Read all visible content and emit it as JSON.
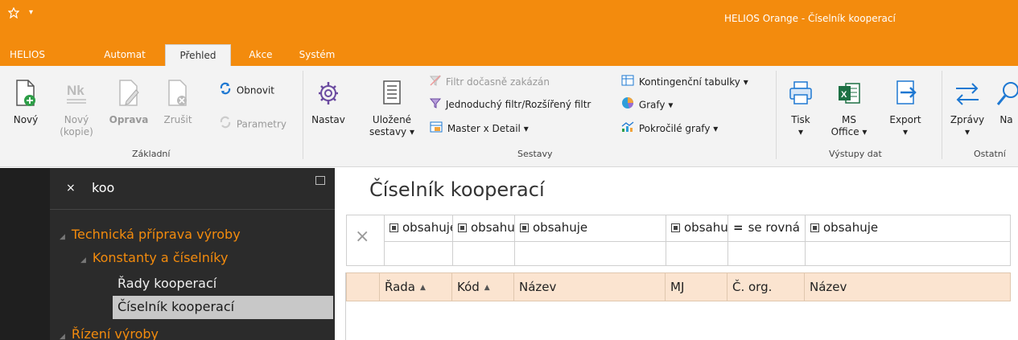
{
  "window": {
    "title": "HELIOS Orange - Číselník kooperací"
  },
  "tabs": [
    {
      "label": "HELIOS"
    },
    {
      "label": "Automat"
    },
    {
      "label": "Přehled"
    },
    {
      "label": "Akce"
    },
    {
      "label": "Systém"
    }
  ],
  "ribbon": {
    "zakladni": {
      "label": "Základní",
      "novy": "Nový",
      "novy_kopie_1": "Nový",
      "novy_kopie_2": "(kopie)",
      "oprava": "Oprava",
      "zrusit": "Zrušit",
      "obnovit": "Obnovit",
      "parametry": "Parametry"
    },
    "sestavy": {
      "label": "Sestavy",
      "nastav": "Nastav",
      "ulozene_1": "Uložené",
      "ulozene_2": "sestavy ▾",
      "filtr_docasne": "Filtr dočasně zakázán",
      "jednoduchy_filtr": "Jednoduchý filtr/Rozšířený filtr",
      "master_detail": "Master x Detail ▾",
      "kontingencni": "Kontingenční tabulky ▾",
      "grafy": "Grafy ▾",
      "pokrocile_grafy": "Pokročilé grafy ▾"
    },
    "vystupy": {
      "label": "Výstupy dat",
      "tisk": "Tisk",
      "tisk_arrow": "▾",
      "ms_1": "MS",
      "ms_2": "Office ▾",
      "export": "Export",
      "export_arrow": "▾"
    },
    "ostatni": {
      "label": "Ostatní",
      "zpravy": "Zprávy",
      "zpravy_arrow": "▾",
      "na": "Na"
    }
  },
  "nav": {
    "search_value": "koo",
    "close": "×",
    "tree": [
      {
        "label": "Technická příprava výroby"
      },
      {
        "label": "Konstanty a číselníky"
      },
      {
        "label": "Řady kooperací"
      },
      {
        "label": "Číselník kooperací"
      },
      {
        "label": "Řízení výroby"
      }
    ]
  },
  "main": {
    "title": "Číselník kooperací",
    "filter_clear": "×",
    "filters": [
      "obsahuje",
      "obsahuje",
      "obsahuje",
      "obsahuje",
      "se rovná",
      "obsahuje"
    ],
    "filter_eq_symbol": "=",
    "columns": [
      "Řada",
      "Kód",
      "Název",
      "MJ",
      "Č. org.",
      "Název"
    ],
    "sort_symbol": "▲"
  },
  "colors": {
    "accent": "#f38b0d",
    "header_bg": "#fbe4d0",
    "nav_bg": "#2b2b2b"
  }
}
